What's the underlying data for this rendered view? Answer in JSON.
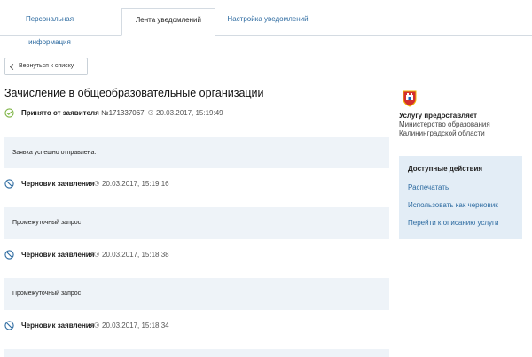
{
  "tabs": [
    {
      "label": "Персональная информация",
      "active": false
    },
    {
      "label": "Лента уведомлений",
      "active": true
    },
    {
      "label": "Настройка уведомлений",
      "active": false
    }
  ],
  "back_button": {
    "label": "Вернуться к списку",
    "icon": "chevron-left-icon"
  },
  "page_title": "Зачисление в общеобразовательные организации",
  "events": [
    {
      "name": "Принято от заявителя",
      "number": "№171337067",
      "time": "20.03.2017, 15:19:49",
      "icon": "check-circle-icon",
      "message": "Заявка успешно отправлена."
    },
    {
      "name": "Черновик заявления",
      "number": "",
      "time": "20.03.2017, 15:19:16",
      "icon": "draft-icon",
      "message": "Промежуточный запрос"
    },
    {
      "name": "Черновик заявления",
      "number": "",
      "time": "20.03.2017, 15:18:38",
      "icon": "draft-icon",
      "message": "Промежуточный запрос"
    },
    {
      "name": "Черновик заявления",
      "number": "",
      "time": "20.03.2017, 15:18:34",
      "icon": "draft-icon",
      "message": ""
    }
  ],
  "provider": {
    "title": "Услугу предоставляет",
    "name": "Министерство образования Калининградской области",
    "icon": "coat-of-arms-icon"
  },
  "actions": {
    "title": "Доступные действия",
    "items": [
      "Распечатать",
      "Использовать как черновик",
      "Перейти к описанию услуги"
    ]
  },
  "colors": {
    "accent": "#2c6aa0",
    "success": "#7cb342",
    "panel": "#e3edf6",
    "message_bg": "#eef3f8"
  }
}
